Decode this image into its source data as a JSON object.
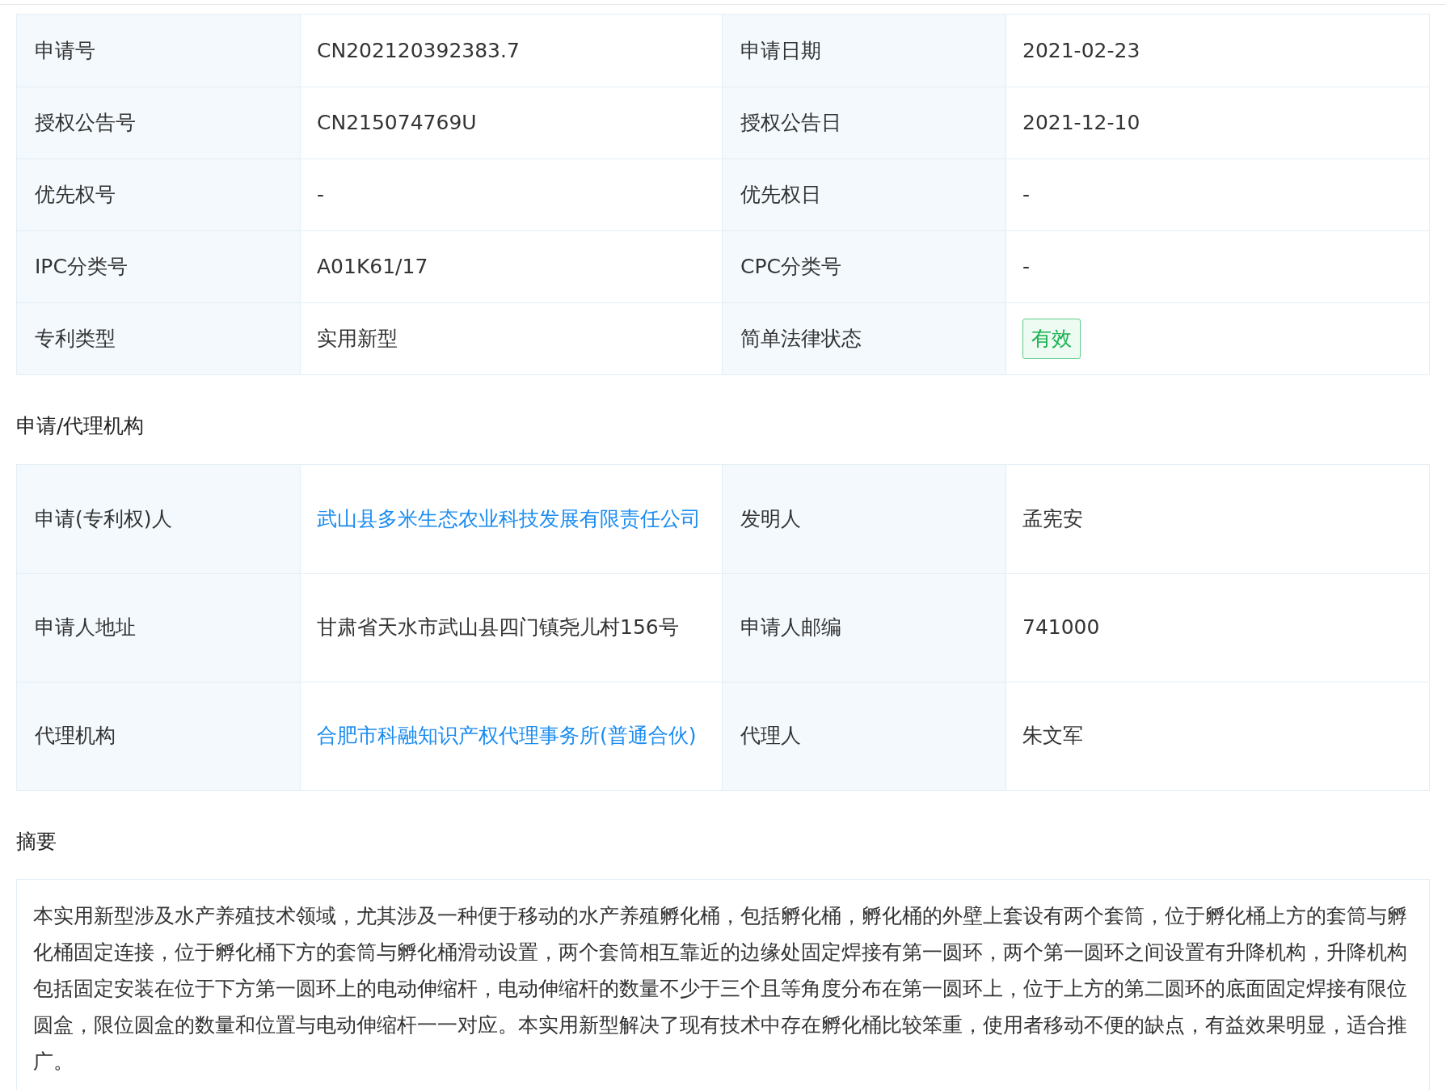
{
  "basic_info": {
    "rows": [
      {
        "cells": [
          {
            "label": "申请号",
            "value": "CN202120392383.7",
            "kind": "text"
          },
          {
            "label": "申请日期",
            "value": "2021-02-23",
            "kind": "text"
          }
        ]
      },
      {
        "cells": [
          {
            "label": "授权公告号",
            "value": "CN215074769U",
            "kind": "text"
          },
          {
            "label": "授权公告日",
            "value": "2021-12-10",
            "kind": "text"
          }
        ]
      },
      {
        "cells": [
          {
            "label": "优先权号",
            "value": "-",
            "kind": "text"
          },
          {
            "label": "优先权日",
            "value": "-",
            "kind": "text"
          }
        ]
      },
      {
        "cells": [
          {
            "label": "IPC分类号",
            "value": "A01K61/17",
            "kind": "text"
          },
          {
            "label": "CPC分类号",
            "value": "-",
            "kind": "text"
          }
        ]
      },
      {
        "cells": [
          {
            "label": "专利类型",
            "value": "实用新型",
            "kind": "text"
          },
          {
            "label": "简单法律状态",
            "value": "有效",
            "kind": "badge"
          }
        ]
      }
    ]
  },
  "agency_section": {
    "title": "申请/代理机构",
    "rows": [
      {
        "cells": [
          {
            "label": "申请(专利权)人",
            "value": "武山县多米生态农业科技发展有限责任公司",
            "kind": "link"
          },
          {
            "label": "发明人",
            "value": "孟宪安",
            "kind": "text"
          }
        ]
      },
      {
        "cells": [
          {
            "label": "申请人地址",
            "value": "甘肃省天水市武山县四门镇尧儿村156号",
            "kind": "text"
          },
          {
            "label": "申请人邮编",
            "value": "741000",
            "kind": "text"
          }
        ]
      },
      {
        "cells": [
          {
            "label": "代理机构",
            "value": "合肥市科融知识产权代理事务所(普通合伙)",
            "kind": "link"
          },
          {
            "label": "代理人",
            "value": "朱文军",
            "kind": "text"
          }
        ]
      }
    ]
  },
  "abstract_section": {
    "title": "摘要",
    "text": "本实用新型涉及水产养殖技术领域，尤其涉及一种便于移动的水产养殖孵化桶，包括孵化桶，孵化桶的外壁上套设有两个套筒，位于孵化桶上方的套筒与孵化桶固定连接，位于孵化桶下方的套筒与孵化桶滑动设置，两个套筒相互靠近的边缘处固定焊接有第一圆环，两个第一圆环之间设置有升降机构，升降机构包括固定安装在位于下方第一圆环上的电动伸缩杆，电动伸缩杆的数量不少于三个且等角度分布在第一圆环上，位于上方的第二圆环的底面固定焊接有限位圆盒，限位圆盒的数量和位置与电动伸缩杆一一对应。本实用新型解决了现有技术中存在孵化桶比较笨重，使用者移动不便的缺点，有益效果明显，适合推广。"
  }
}
